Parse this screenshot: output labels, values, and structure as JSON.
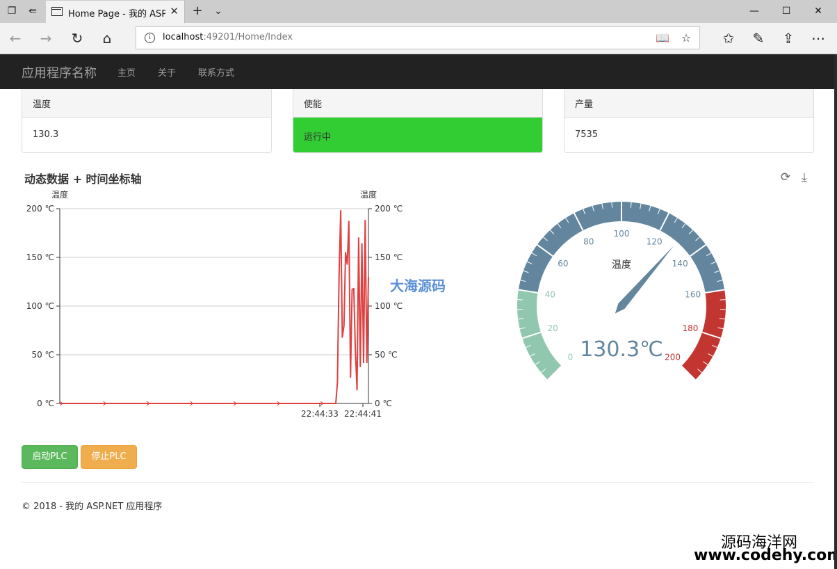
{
  "browser": {
    "tab_title": "Home Page - 我的 ASP.",
    "address_host": "localhost",
    "address_rest": ":49201/Home/Index"
  },
  "app": {
    "brand": "应用程序名称",
    "nav": [
      "主页",
      "关于",
      "联系方式"
    ]
  },
  "panels": [
    {
      "title": "温度",
      "value": "130.3"
    },
    {
      "title": "使能",
      "value": "运行中"
    },
    {
      "title": "产量",
      "value": "7535"
    }
  ],
  "chart": {
    "title": "动态数据 + 时间坐标轴",
    "watermark": "大海源码"
  },
  "chart_data": [
    {
      "type": "line",
      "title": "动态数据 + 时间坐标轴",
      "ylabel": "温度",
      "ylabel_right": "温度",
      "ylim": [
        0,
        200
      ],
      "y_ticks": [
        "0 ℃",
        "50 ℃",
        "100 ℃",
        "150 ℃",
        "200 ℃"
      ],
      "x_tick_labels": [
        "22:44:33",
        "22:44:41"
      ],
      "grid": true,
      "color": "#e04040",
      "values": [
        0,
        0,
        0,
        0,
        0,
        0,
        0,
        0,
        0,
        0,
        0,
        0,
        0,
        0,
        0,
        0,
        0,
        0,
        0,
        0,
        0,
        0,
        0,
        0,
        0,
        0,
        0,
        0,
        0,
        0,
        0,
        0,
        0,
        0,
        0,
        0,
        0,
        0,
        0,
        0,
        0,
        0,
        0,
        0,
        0,
        0,
        0,
        0,
        0,
        0,
        0,
        0,
        0,
        0,
        0,
        0,
        0,
        0,
        0,
        0,
        0,
        0,
        0,
        0,
        0,
        0,
        0,
        0,
        0,
        0,
        0,
        0,
        0,
        0,
        0,
        0,
        0,
        0,
        0,
        0,
        0,
        0,
        0,
        0,
        0,
        0,
        0,
        0,
        0,
        0,
        0,
        0,
        0,
        0,
        0,
        0,
        0,
        0,
        0,
        0,
        0,
        0,
        0,
        0,
        0,
        0,
        0,
        0,
        0,
        0,
        0,
        0,
        0,
        0,
        0,
        0,
        0,
        0,
        0,
        0,
        0,
        0,
        0,
        0,
        0,
        0,
        0,
        0,
        0,
        0,
        0,
        0,
        0,
        0,
        0,
        0,
        0,
        0,
        0,
        0,
        0,
        0,
        0,
        0,
        0,
        0,
        0,
        0,
        0,
        0,
        0,
        0,
        0,
        0,
        0,
        0,
        0,
        0,
        0,
        0,
        0,
        0,
        0,
        0,
        0,
        0,
        0,
        0,
        0,
        0,
        22,
        130,
        198,
        68,
        80,
        155,
        143,
        187,
        27,
        117,
        118,
        54,
        14,
        170,
        38,
        164,
        42,
        188,
        42,
        130
      ]
    },
    {
      "type": "gauge",
      "title": "温度",
      "value": 130.3,
      "unit": "℃",
      "min": 0,
      "max": 200,
      "tick_labels": [
        "0",
        "20",
        "40",
        "60",
        "80",
        "100",
        "120",
        "140",
        "160",
        "180",
        "200"
      ],
      "bands": [
        {
          "to": 40,
          "color": "#91c7ae"
        },
        {
          "to": 160,
          "color": "#63869e"
        },
        {
          "to": 200,
          "color": "#c23531"
        }
      ],
      "detail": "130.3℃"
    }
  ],
  "buttons": {
    "start": "启动PLC",
    "stop": "停止PLC"
  },
  "footer": "© 2018 - 我的 ASP.NET 应用程序",
  "watermark_site": {
    "name": "源码海洋网",
    "url": "www.codehy.com"
  }
}
